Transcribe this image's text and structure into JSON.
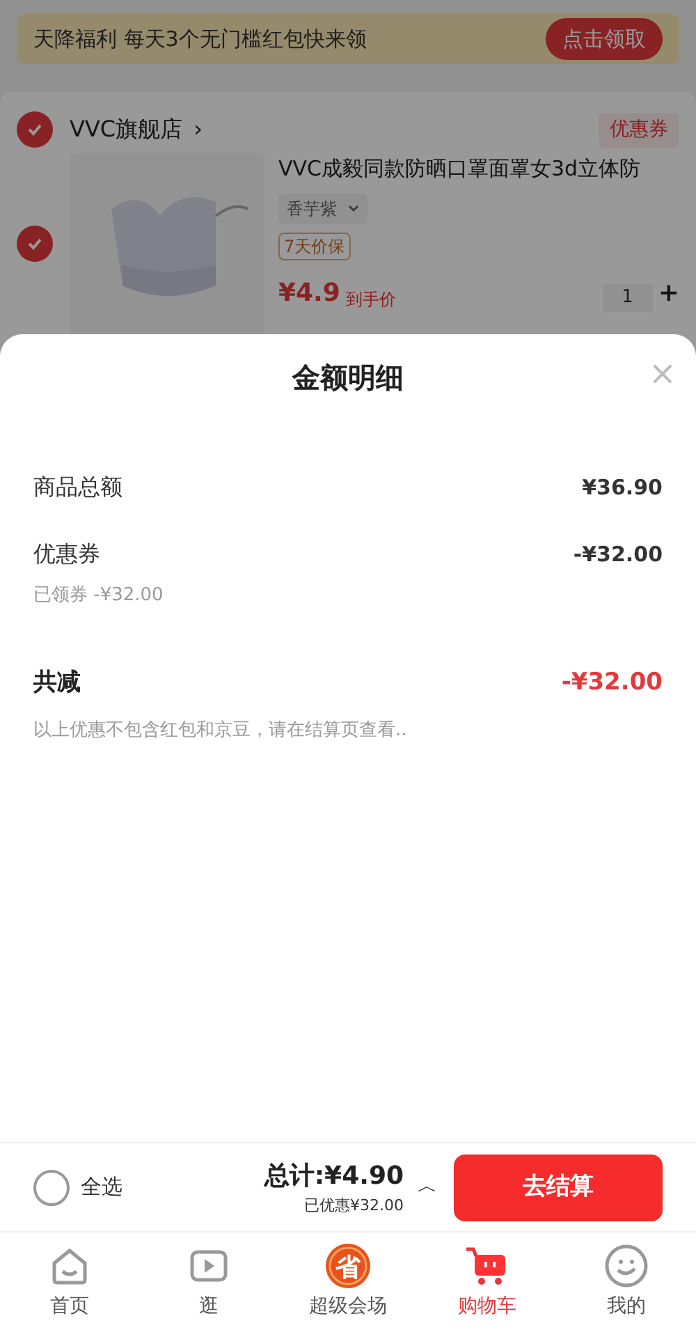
{
  "banner": {
    "text": "天降福利 每天3个无门槛红包快来领",
    "button": "点击领取"
  },
  "store": {
    "name": "VVC旗舰店",
    "chevron": "›",
    "checked": true,
    "coupon": "优惠券"
  },
  "product": {
    "checked": true,
    "title": "VVC成毅同款防晒口罩面罩女3d立体防",
    "variant": "香芋紫",
    "tag": "7天价保",
    "currency": "¥",
    "price": "4.9",
    "price_note": "到手价",
    "quantity": "1",
    "plus": "+"
  },
  "sheet": {
    "title": "金额明细",
    "close": "×",
    "rows": [
      {
        "kind": "line",
        "label": "商品总额",
        "value": "¥36.90"
      },
      {
        "kind": "line",
        "label": "优惠券",
        "value": "-¥32.00",
        "note": "已领券 -¥32.00"
      },
      {
        "kind": "total",
        "label": "共减",
        "value": "-¥32.00",
        "note": "以上优惠不包含红包和京豆，请在结算页查看.."
      }
    ]
  },
  "checkout": {
    "select_all": {
      "label": "全选",
      "checked": false
    },
    "total": "总计:¥4.90",
    "saved": "已优惠¥32.00",
    "caret": "︿",
    "button": "去结算"
  },
  "tabs": [
    {
      "label": "首页",
      "kind": "home",
      "selected": false
    },
    {
      "label": "逛",
      "kind": "video",
      "selected": false
    },
    {
      "label": "超级会场",
      "kind": "promo",
      "icon_text": "省",
      "selected": false
    },
    {
      "label": "购物车",
      "kind": "cart",
      "selected": true
    },
    {
      "label": "我的",
      "kind": "smile",
      "selected": false
    }
  ]
}
